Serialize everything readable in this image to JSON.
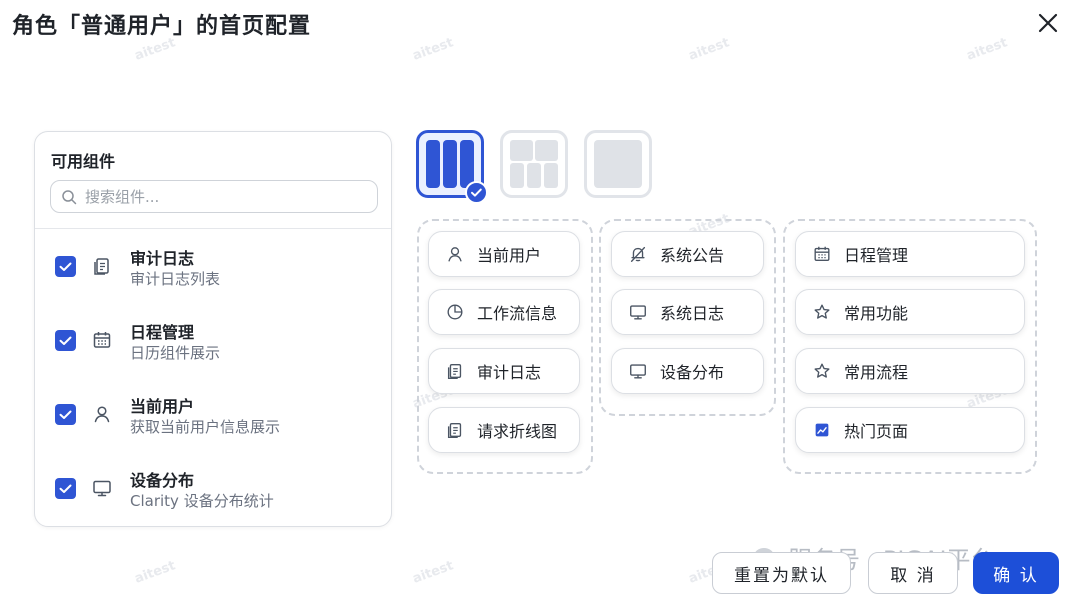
{
  "dialog": {
    "title": "角色「普通用户」的首页配置"
  },
  "panel": {
    "title": "可用组件",
    "search_placeholder": "搜索组件...",
    "items": [
      {
        "name": "审计日志",
        "desc": "审计日志列表",
        "checked": true,
        "icon": "document-icon"
      },
      {
        "name": "日程管理",
        "desc": "日历组件展示",
        "checked": true,
        "icon": "calendar-icon"
      },
      {
        "name": "当前用户",
        "desc": "获取当前用户信息展示",
        "checked": true,
        "icon": "user-icon"
      },
      {
        "name": "设备分布",
        "desc": "Clarity 设备分布统计",
        "checked": true,
        "icon": "monitor-icon"
      }
    ]
  },
  "layouts": [
    {
      "icon": "three-column-layout-icon",
      "selected": true
    },
    {
      "icon": "grid-layout-icon",
      "selected": false
    },
    {
      "icon": "single-block-layout-icon",
      "selected": false
    }
  ],
  "columns": [
    {
      "cards": [
        {
          "label": "当前用户",
          "icon": "user-icon"
        },
        {
          "label": "工作流信息",
          "icon": "pie-chart-icon"
        },
        {
          "label": "审计日志",
          "icon": "document-icon"
        },
        {
          "label": "请求折线图",
          "icon": "document-icon"
        }
      ]
    },
    {
      "cards": [
        {
          "label": "系统公告",
          "icon": "bell-off-icon"
        },
        {
          "label": "系统日志",
          "icon": "monitor-icon"
        },
        {
          "label": "设备分布",
          "icon": "monitor-icon"
        }
      ]
    },
    {
      "cards": [
        {
          "label": "日程管理",
          "icon": "calendar-icon"
        },
        {
          "label": "常用功能",
          "icon": "star-icon"
        },
        {
          "label": "常用流程",
          "icon": "star-icon"
        },
        {
          "label": "热门页面",
          "icon": "trend-chart-icon"
        }
      ]
    }
  ],
  "buttons": {
    "reset": "重置为默认",
    "cancel": "取 消",
    "confirm": "确 认"
  },
  "watermark": "aitest",
  "official_account": "服务号 · PIGAI平台",
  "colors": {
    "primary": "#2f55d4",
    "border": "#dcdfe4",
    "dashed": "#cfd3da",
    "text": "#1f2329",
    "muted": "#6b7280"
  }
}
